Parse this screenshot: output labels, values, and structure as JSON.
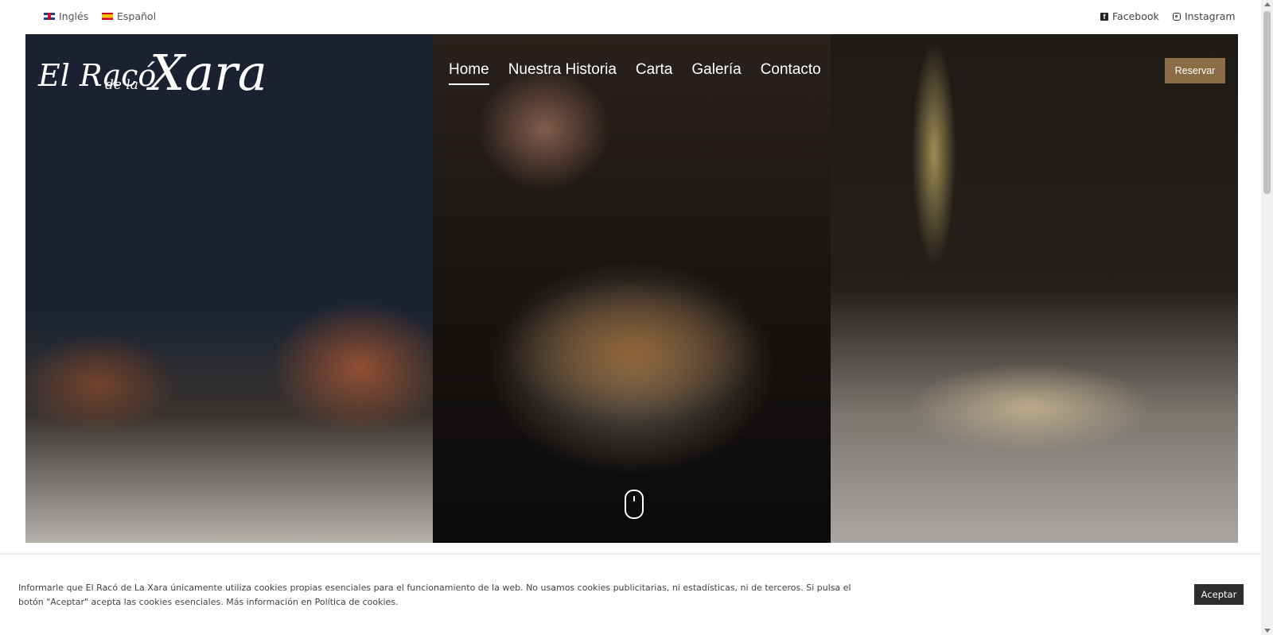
{
  "topbar": {
    "languages": [
      {
        "label": "Inglés",
        "icon": "uk-flag-icon"
      },
      {
        "label": "Español",
        "icon": "spain-flag-icon"
      }
    ],
    "social": [
      {
        "label": "Facebook",
        "icon": "facebook-icon"
      },
      {
        "label": "Instagram",
        "icon": "instagram-icon"
      }
    ]
  },
  "header": {
    "logo": {
      "line1": "El Racó",
      "line2": "de la",
      "line3": "Xara"
    },
    "nav": [
      {
        "label": "Home",
        "active": true
      },
      {
        "label": "Nuestra Historia",
        "active": false
      },
      {
        "label": "Carta",
        "active": false
      },
      {
        "label": "Galería",
        "active": false
      },
      {
        "label": "Contacto",
        "active": false
      }
    ],
    "reserve_label": "Reservar"
  },
  "cookie_banner": {
    "text": "Informarle que El Racó de La Xara únicamente utiliza cookies propias esenciales para el funcionamiento de la web. No usamos cookies publicitarias, ni estadísticas, ni de terceros. Si pulsa el botón \"Aceptar\" acepta las cookies esenciales. Más información en Política de cookies.",
    "accept_label": "Aceptar"
  },
  "colors": {
    "accent": "#8a6d45",
    "button_dark": "#2d2d2d"
  }
}
